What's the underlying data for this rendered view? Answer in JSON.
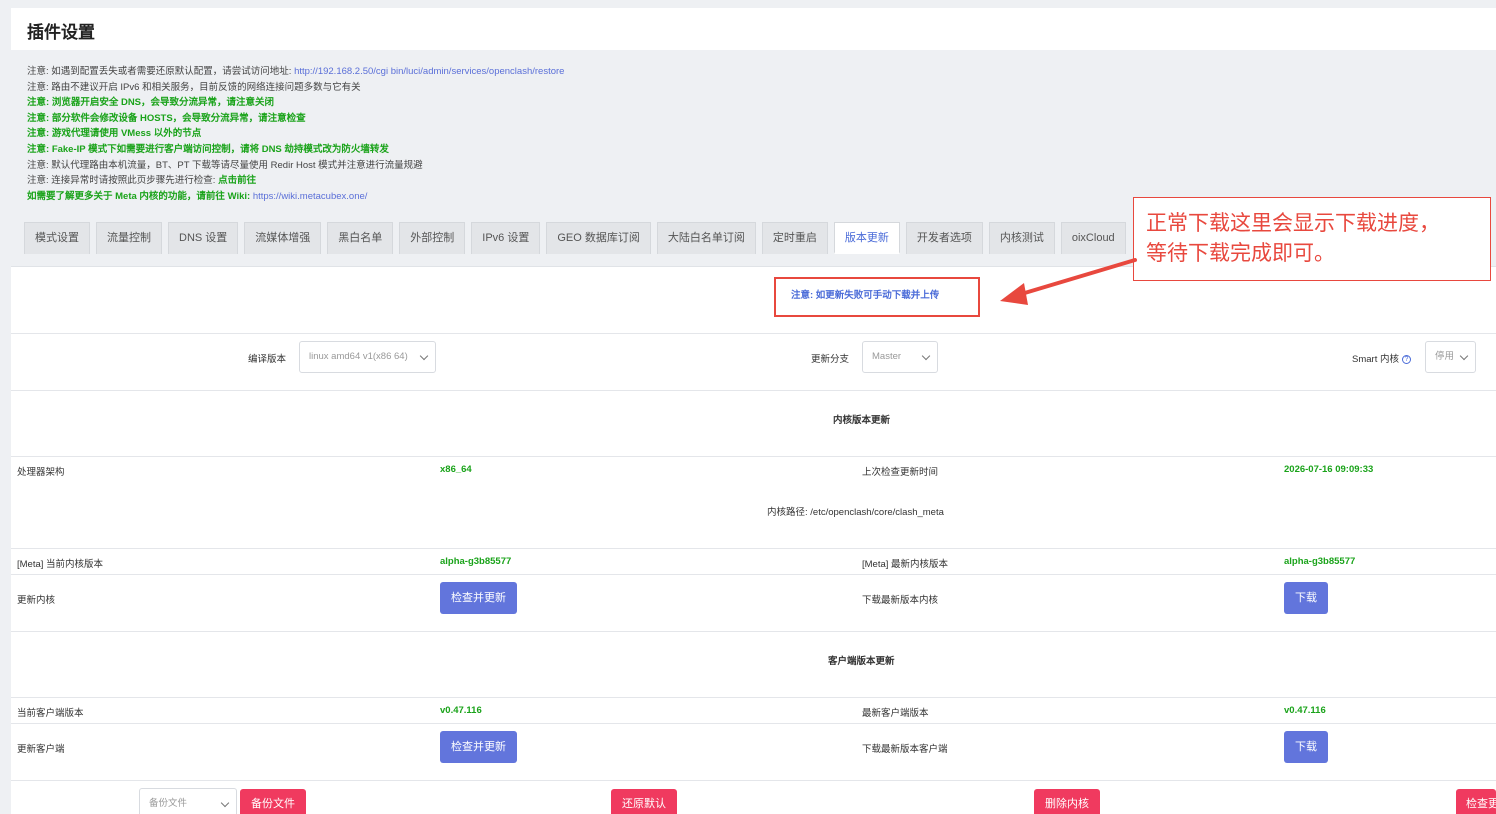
{
  "page": {
    "title": "插件设置"
  },
  "notes": [
    {
      "prefix": "注意: ",
      "text": "如遇到配置丢失或者需要还原默认配置，请尝试访问地址: ",
      "link": "http://192.168.2.50/cgi bin/luci/admin/services/openclash/restore",
      "green": false
    },
    {
      "prefix": "注意: ",
      "text": "路由不建议开启 IPv6 和相关服务，目前反馈的网络连接问题多数与它有关",
      "link": "",
      "green": false
    },
    {
      "prefix": "注意: ",
      "text": "浏览器开启安全 DNS，会导致分流异常，请注意关闭",
      "link": "",
      "green": true
    },
    {
      "prefix": "注意: ",
      "text": "部分软件会修改设备 HOSTS，会导致分流异常，请注意检查",
      "link": "",
      "green": true
    },
    {
      "prefix": "注意: ",
      "text": "游戏代理请使用 VMess 以外的节点",
      "link": "",
      "green": true
    },
    {
      "prefix": "注意: ",
      "text": "Fake-IP 模式下如需要进行客户端访问控制，请将 DNS 劫持模式改为防火墙转发",
      "link": "",
      "green": true
    },
    {
      "prefix": "注意: ",
      "text": "默认代理路由本机流量，BT、PT 下载等请尽量使用 Redir Host 模式并注意进行流量规避",
      "link": "",
      "green": false
    },
    {
      "prefix": "注意: ",
      "text": "连接异常时请按照此页步骤先进行检查: ",
      "link": "",
      "green": false,
      "suffix_green": "点击前往"
    },
    {
      "prefix": "",
      "text": "如需要了解更多关于 Meta 内核的功能，请前往 Wiki: ",
      "link": "https://wiki.metacubex.one/",
      "green": true
    }
  ],
  "tabs": [
    "模式设置",
    "流量控制",
    "DNS 设置",
    "流媒体增强",
    "黑白名单",
    "外部控制",
    "IPv6 设置",
    "GEO 数据库订阅",
    "大陆白名单订阅",
    "定时重启",
    "版本更新",
    "开发者选项",
    "内核测试",
    "oixCloud"
  ],
  "active_tab": "版本更新",
  "notice": "注意: 如更新失败可手动下载并上传",
  "callout": {
    "line1": "正常下载这里会显示下载进度，",
    "line2": "等待下载完成即可。"
  },
  "settings": {
    "compile_label": "编译版本",
    "compile_value": "linux amd64 v1(x86 64)",
    "branch_label": "更新分支",
    "branch_value": "Master",
    "smart_label": "Smart 内核",
    "smart_value": "停用"
  },
  "core": {
    "section_title": "内核版本更新",
    "arch_label": "处理器架构",
    "arch_value": "x86_64",
    "last_check_label": "上次检查更新时间",
    "last_check_value": "2026-07-16 09:09:33",
    "path_text": "内核路径: /etc/openclash/core/clash_meta",
    "current_label": "[Meta] 当前内核版本",
    "current_value": "alpha-g3b85577",
    "latest_label": "[Meta] 最新内核版本",
    "latest_value": "alpha-g3b85577",
    "update_label": "更新内核",
    "update_button": "检查并更新",
    "download_label": "下载最新版本内核",
    "download_button": "下载"
  },
  "client": {
    "section_title": "客户端版本更新",
    "current_label": "当前客户端版本",
    "current_value": "v0.47.116",
    "latest_label": "最新客户端版本",
    "latest_value": "v0.47.116",
    "update_label": "更新客户端",
    "update_button": "检查并更新",
    "download_label": "下载最新版本客户端",
    "download_button": "下载"
  },
  "footer": {
    "backup_select": "备份文件",
    "backup_button": "备份文件",
    "restore_button": "还原默认",
    "delete_button": "删除内核",
    "check_button": "检查更"
  },
  "colors": {
    "accent": "#6275dc",
    "green": "#1aa31a",
    "danger": "#f03a5f",
    "annotation": "#e8483e"
  }
}
